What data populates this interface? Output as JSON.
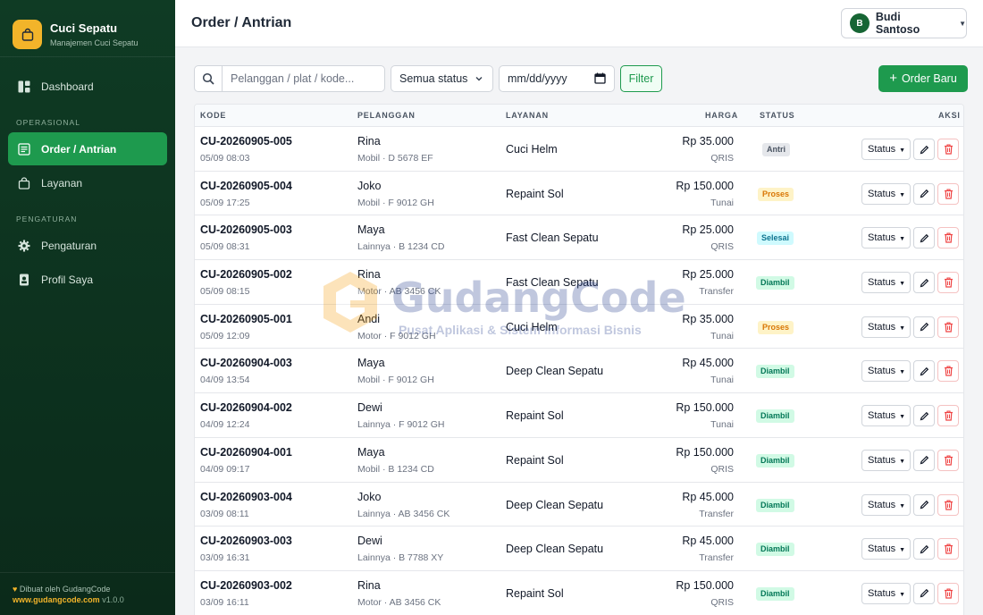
{
  "app": {
    "name": "Cuci Sepatu",
    "subtitle": "Manajemen Cuci Sepatu",
    "brand_color": "#1e9a4e",
    "logo_icon": "shopping-bag-icon"
  },
  "sidebar": {
    "items_top": [
      {
        "label": "Dashboard",
        "icon": "dashboard-icon",
        "active": false
      }
    ],
    "section_operasional": "OPERASIONAL",
    "items_operasional": [
      {
        "label": "Order / Antrian",
        "icon": "receipt-icon",
        "active": true
      },
      {
        "label": "Layanan",
        "icon": "bag-icon",
        "active": false
      }
    ],
    "section_pengaturan": "PENGATURAN",
    "items_pengaturan": [
      {
        "label": "Pengaturan",
        "icon": "gear-icon",
        "active": false
      },
      {
        "label": "Profil Saya",
        "icon": "id-badge-icon",
        "active": false
      }
    ],
    "footer": {
      "made_by": "Dibuat oleh GudangCode",
      "url": "www.gudangcode.com",
      "version": "v1.0.0"
    }
  },
  "header": {
    "title": "Order / Antrian",
    "user": {
      "initial": "B",
      "name": "Budi Santoso"
    }
  },
  "toolbar": {
    "search_placeholder": "Pelanggan / plat / kode...",
    "status_select": "Semua status",
    "date_placeholder": "mm/dd/yyyy",
    "filter_label": "Filter",
    "new_order_label": "Order Baru"
  },
  "table": {
    "headers": {
      "kode": "KODE",
      "pelanggan": "PELANGGAN",
      "layanan": "LAYANAN",
      "harga": "HARGA",
      "status": "STATUS",
      "aksi": "AKSI"
    },
    "status_button_label": "Status",
    "rows": [
      {
        "code": "CU-20260905-005",
        "time": "05/09 08:03",
        "customer": "Rina",
        "vehicle": "Mobil · D 5678 EF",
        "service": "Cuci Helm",
        "price": "Rp 35.000",
        "payment": "QRIS",
        "status": "Antri",
        "status_kind": "antri"
      },
      {
        "code": "CU-20260905-004",
        "time": "05/09 17:25",
        "customer": "Joko",
        "vehicle": "Mobil · F 9012 GH",
        "service": "Repaint Sol",
        "price": "Rp 150.000",
        "payment": "Tunai",
        "status": "Proses",
        "status_kind": "proses"
      },
      {
        "code": "CU-20260905-003",
        "time": "05/09 08:31",
        "customer": "Maya",
        "vehicle": "Lainnya · B 1234 CD",
        "service": "Fast Clean Sepatu",
        "price": "Rp 25.000",
        "payment": "QRIS",
        "status": "Selesai",
        "status_kind": "selesai"
      },
      {
        "code": "CU-20260905-002",
        "time": "05/09 08:15",
        "customer": "Rina",
        "vehicle": "Motor · AB 3456 CK",
        "service": "Fast Clean Sepatu",
        "price": "Rp 25.000",
        "payment": "Transfer",
        "status": "Diambil",
        "status_kind": "diambil"
      },
      {
        "code": "CU-20260905-001",
        "time": "05/09 12:09",
        "customer": "Andi",
        "vehicle": "Motor · F 9012 GH",
        "service": "Cuci Helm",
        "price": "Rp 35.000",
        "payment": "Tunai",
        "status": "Proses",
        "status_kind": "proses"
      },
      {
        "code": "CU-20260904-003",
        "time": "04/09 13:54",
        "customer": "Maya",
        "vehicle": "Mobil · F 9012 GH",
        "service": "Deep Clean Sepatu",
        "price": "Rp 45.000",
        "payment": "Tunai",
        "status": "Diambil",
        "status_kind": "diambil"
      },
      {
        "code": "CU-20260904-002",
        "time": "04/09 12:24",
        "customer": "Dewi",
        "vehicle": "Lainnya · F 9012 GH",
        "service": "Repaint Sol",
        "price": "Rp 150.000",
        "payment": "Tunai",
        "status": "Diambil",
        "status_kind": "diambil"
      },
      {
        "code": "CU-20260904-001",
        "time": "04/09 09:17",
        "customer": "Maya",
        "vehicle": "Mobil · B 1234 CD",
        "service": "Repaint Sol",
        "price": "Rp 150.000",
        "payment": "QRIS",
        "status": "Diambil",
        "status_kind": "diambil"
      },
      {
        "code": "CU-20260903-004",
        "time": "03/09 08:11",
        "customer": "Joko",
        "vehicle": "Lainnya · AB 3456 CK",
        "service": "Deep Clean Sepatu",
        "price": "Rp 45.000",
        "payment": "Transfer",
        "status": "Diambil",
        "status_kind": "diambil"
      },
      {
        "code": "CU-20260903-003",
        "time": "03/09 16:31",
        "customer": "Dewi",
        "vehicle": "Lainnya · B 7788 XY",
        "service": "Deep Clean Sepatu",
        "price": "Rp 45.000",
        "payment": "Transfer",
        "status": "Diambil",
        "status_kind": "diambil"
      },
      {
        "code": "CU-20260903-002",
        "time": "03/09 16:11",
        "customer": "Rina",
        "vehicle": "Motor · AB 3456 CK",
        "service": "Repaint Sol",
        "price": "Rp 150.000",
        "payment": "QRIS",
        "status": "Diambil",
        "status_kind": "diambil"
      }
    ]
  },
  "watermark": {
    "title": "GudangCode",
    "subtitle": "Pusat Aplikasi & Sistem Informasi Bisnis"
  }
}
